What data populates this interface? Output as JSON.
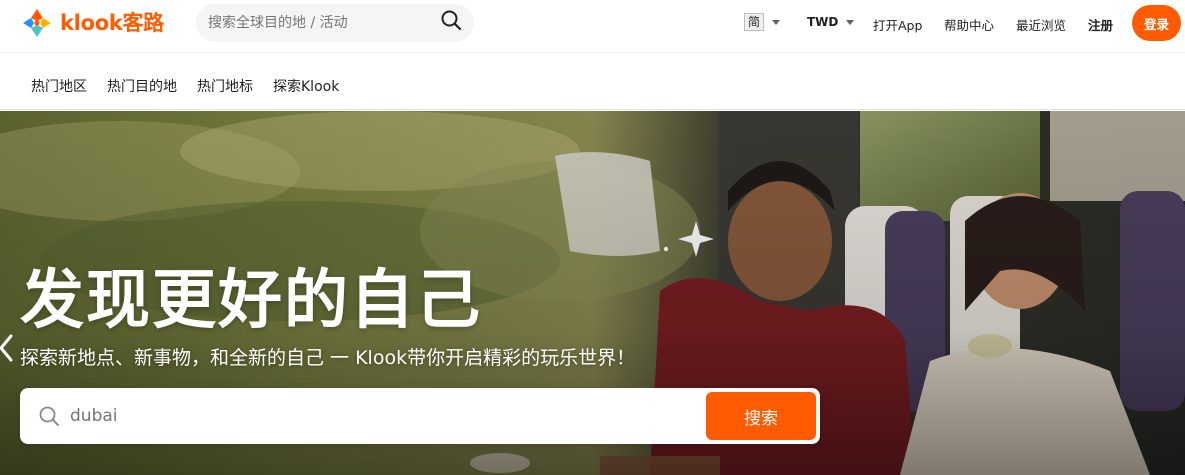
{
  "brand": {
    "name": "klook客路",
    "accent": "#ff5b00"
  },
  "header": {
    "search_placeholder": "搜索全球目的地 / 活动",
    "language": "简",
    "currency": "TWD",
    "links": {
      "open_app": "打开App",
      "help_center": "帮助中心",
      "recently_viewed": "最近浏览",
      "register": "注册"
    },
    "login": "登录"
  },
  "categories": [
    "热门地区",
    "热门目的地",
    "热门地标",
    "探索Klook"
  ],
  "hero": {
    "title": "发现更好的自己",
    "subtitle": "探索新地点、新事物，和全新的自己 一 Klook带你开启精彩的玩乐世界！",
    "search_value": "dubai",
    "search_button": "搜索"
  },
  "icons": {
    "search": "search-icon",
    "caret": "chevron-down-icon",
    "prev": "chevron-left-icon",
    "logo": "klook-logo-icon"
  }
}
